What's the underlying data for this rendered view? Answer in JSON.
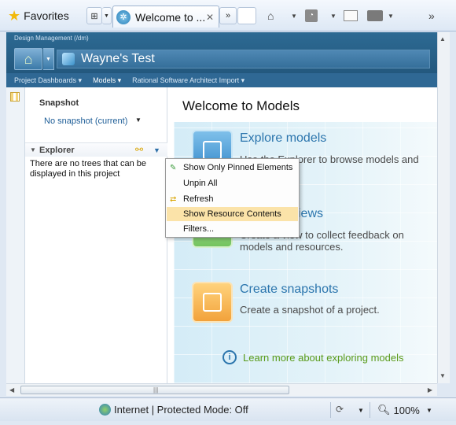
{
  "browser": {
    "favorites_label": "Favorites",
    "tab_title": "Welcome to ...",
    "tab_close": "✕",
    "overflow": "»",
    "status_zone": "Internet | Protected Mode: Off",
    "zoom": "100%"
  },
  "rtc": {
    "breadcrumb": "Design Management (/dm)",
    "project_title": "Wayne's Test",
    "nav": [
      "Project Dashboards ▾",
      "Models ▾",
      "Rational Software Architect Import ▾"
    ]
  },
  "sidebar": {
    "snapshot_title": "Snapshot",
    "snapshot_value": "No snapshot (current)",
    "explorer_title": "Explorer",
    "empty_message": "There are no trees that can be displayed in this project"
  },
  "context_menu": {
    "items": [
      {
        "label": "Show Only Pinned Elements",
        "icon": "pin-icon"
      },
      {
        "label": "Unpin All",
        "icon": ""
      },
      {
        "label": "Refresh",
        "icon": "refresh-icon"
      },
      {
        "label": "Show Resource Contents",
        "icon": ""
      },
      {
        "label": "Filters...",
        "icon": ""
      }
    ],
    "highlighted_index": 3
  },
  "main": {
    "title": "Welcome to Models",
    "sections": [
      {
        "title": "Explore models",
        "desc": "Use the Explorer to browse models and"
      },
      {
        "title": "views",
        "desc": "Create a view to collect feedback on models and resources."
      },
      {
        "title": "Create snapshots",
        "desc": "Create a snapshot of a project."
      }
    ],
    "learn_more": "Learn more about exploring models"
  },
  "colors": {
    "rtc_header": "#2d6a93",
    "link_blue": "#2b75ad",
    "menu_highlight": "#fbe3a9",
    "learn_green": "#5a9b1a"
  }
}
